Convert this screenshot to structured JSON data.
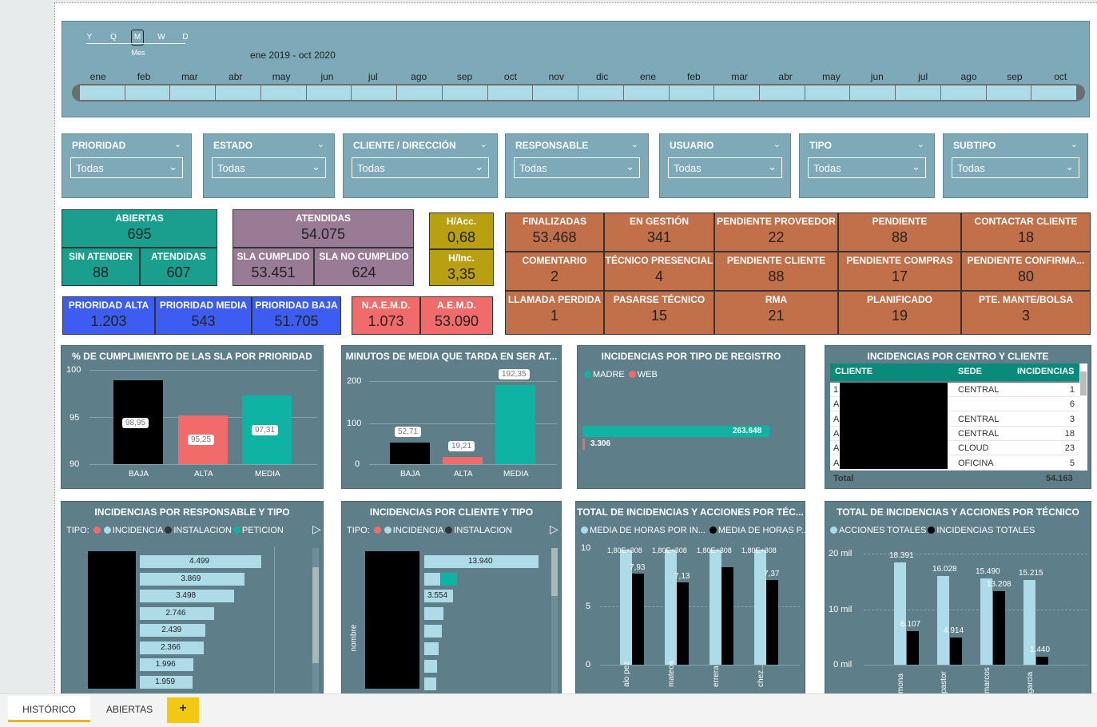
{
  "timeline": {
    "gran": [
      "Y",
      "Q",
      "M",
      "W",
      "D"
    ],
    "gran_label": "Mes",
    "range": "ene 2019 - oct 2020",
    "months": [
      "ene",
      "feb",
      "mar",
      "abr",
      "may",
      "jun",
      "jul",
      "ago",
      "sep",
      "oct",
      "nov",
      "dic",
      "ene",
      "feb",
      "mar",
      "abr",
      "may",
      "jun",
      "jul",
      "ago",
      "sep",
      "oct"
    ]
  },
  "slicers": [
    {
      "t": "PRIORIDAD",
      "v": "Todas"
    },
    {
      "t": "ESTADO",
      "v": "Todas"
    },
    {
      "t": "CLIENTE / DIRECCIÓN",
      "v": "Todas"
    },
    {
      "t": "RESPONSABLE",
      "v": "Todas"
    },
    {
      "t": "USUARIO",
      "v": "Todas"
    },
    {
      "t": "TIPO",
      "v": "Todas"
    },
    {
      "t": "SUBTIPO",
      "v": "Todas"
    }
  ],
  "kpi": {
    "abiertas": {
      "l": "ABIERTAS",
      "v": "695"
    },
    "sin_atender": {
      "l": "SIN ATENDER",
      "v": "88"
    },
    "atendidas_a": {
      "l": "ATENDIDAS",
      "v": "607"
    },
    "atendidas": {
      "l": "ATENDIDAS",
      "v": "54.075"
    },
    "sla_cumplido": {
      "l": "SLA CUMPLIDO",
      "v": "53.451"
    },
    "sla_no": {
      "l": "SLA NO CUMPLIDO",
      "v": "624"
    },
    "hacc": {
      "l": "H/Acc.",
      "v": "0,68"
    },
    "hinc": {
      "l": "H/Inc.",
      "v": "3,35"
    },
    "p_alta": {
      "l": "PRIORIDAD ALTA",
      "v": "1.203"
    },
    "p_media": {
      "l": "PRIORIDAD MEDIA",
      "v": "543"
    },
    "p_baja": {
      "l": "PRIORIDAD BAJA",
      "v": "51.705"
    },
    "naemd": {
      "l": "N.A.E.M.D.",
      "v": "1.073"
    },
    "aemd": {
      "l": "A.E.M.D.",
      "v": "53.090"
    },
    "states": [
      {
        "l": "FINALIZADAS",
        "v": "53.468"
      },
      {
        "l": "EN GESTIÓN",
        "v": "341"
      },
      {
        "l": "PENDIENTE PROVEEDOR",
        "v": "22"
      },
      {
        "l": "PENDIENTE",
        "v": "88"
      },
      {
        "l": "CONTACTAR CLIENTE",
        "v": "18"
      },
      {
        "l": "COMENTARIO",
        "v": "2"
      },
      {
        "l": "TÉCNICO PRESENCIAL",
        "v": "4"
      },
      {
        "l": "PENDIENTE CLIENTE",
        "v": "88"
      },
      {
        "l": "PENDIENTE COMPRAS",
        "v": "17"
      },
      {
        "l": "PENDIENTE CONFIRMA...",
        "v": "80"
      },
      {
        "l": "LLAMADA PERDIDA",
        "v": "1"
      },
      {
        "l": "PASARSE TÉCNICO",
        "v": "15"
      },
      {
        "l": "RMA",
        "v": "21"
      },
      {
        "l": "PLANIFICADO",
        "v": "19"
      },
      {
        "l": "PTE. MANTE/BOLSA",
        "v": "3"
      }
    ]
  },
  "charts": {
    "sla": {
      "title": "% DE CUMPLIMIENTO DE LAS SLA POR PRIORIDAD",
      "y": [
        "100",
        "95",
        "90"
      ],
      "cats": [
        "BAJA",
        "ALTA",
        "MEDIA"
      ],
      "labels": [
        "98,95",
        "95,25",
        "97,31"
      ]
    },
    "minutos": {
      "title": "MINUTOS DE MEDIA QUE TARDA EN SER AT...",
      "y": [
        "200",
        "100",
        "0"
      ],
      "cats": [
        "BAJA",
        "ALTA",
        "MEDIA"
      ],
      "labels": [
        "52,71",
        "19,21",
        "192,35"
      ]
    },
    "registro": {
      "title": "INCIDENCIAS POR TIPO DE REGISTRO",
      "legend": [
        "MADRE",
        "WEB"
      ],
      "v1": "263.648",
      "v2": "3.306"
    },
    "centro": {
      "title": "INCIDENCIAS POR CENTRO Y CLIENTE",
      "cols": [
        "CLIENTE",
        "SEDE",
        "INCIDENCIAS"
      ],
      "rows": [
        [
          "1",
          "CENTRAL",
          "1"
        ],
        [
          "A",
          "",
          "6"
        ],
        [
          "A",
          "CENTRAL",
          "3"
        ],
        [
          "A",
          "CENTRAL",
          "18"
        ],
        [
          "A",
          "CLOUD",
          "23"
        ],
        [
          "A",
          "OFICINA",
          "5"
        ]
      ],
      "total_l": "Total",
      "total_v": "54.163"
    },
    "resp": {
      "title": "INCIDENCIAS POR RESPONSABLE Y TIPO",
      "tipo": "TIPO:",
      "legend": [
        "INCIDENCIA",
        "INSTALACION",
        "PETICION"
      ],
      "vals": [
        "4.499",
        "3.869",
        "3.498",
        "2.746",
        "2.439",
        "2.366",
        "1.996",
        "1.959"
      ]
    },
    "cli": {
      "title": "INCIDENCIAS POR CLIENTE Y TIPO",
      "tipo": "TIPO:",
      "legend": [
        "INCIDENCIA",
        "INSTALACION"
      ],
      "vals": [
        "13.940",
        "",
        "3.554"
      ],
      "ylabel": "nombre"
    },
    "tec1": {
      "title": "TOTAL DE INCIDENCIAS Y ACCIONES POR TÉC...",
      "legend": [
        "MEDIA DE HORAS POR IN...",
        "MEDIA DE HORAS P..."
      ],
      "y": [
        "10",
        "5",
        "0"
      ],
      "top": [
        "1,80E+308",
        "1,80E+308",
        "1,80E+308",
        "1,80E+308"
      ],
      "vals": [
        "7,93",
        "7,13",
        "",
        "7,37"
      ],
      "names": [
        "alo pez",
        "mateos",
        "errera",
        "chez..."
      ]
    },
    "tec2": {
      "title": "TOTAL DE INCIDENCIAS Y ACCIONES POR TÉCNICO",
      "legend": [
        "ACCIONES TOTALES",
        "INCIDENCIAS TOTALES"
      ],
      "y": [
        "20 mil",
        "10 mil",
        "0 mil"
      ],
      "a": [
        "18.391",
        "16.028",
        "15.490",
        "15.215"
      ],
      "b": [
        "6.107",
        "4.914",
        "13.208",
        "1.440"
      ],
      "names": [
        "mona",
        "pastor",
        "marcos",
        "garcia"
      ]
    }
  },
  "tabs": [
    "HISTÓRICO",
    "ABIERTAS",
    "+"
  ]
}
